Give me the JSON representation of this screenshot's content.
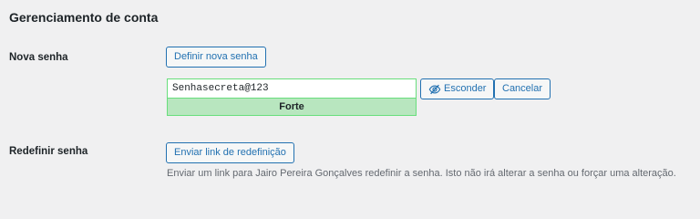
{
  "section": {
    "title": "Gerenciamento de conta"
  },
  "new_password": {
    "label": "Nova senha",
    "generate_button": "Definir nova senha",
    "password_value": "Senhasecreta@123",
    "strength": "Forte",
    "hide_button": "Esconder",
    "cancel_button": "Cancelar",
    "hide_icon": "eye-slash-icon"
  },
  "reset_password": {
    "label": "Redefinir senha",
    "send_link_button": "Enviar link de redefinição",
    "description": "Enviar um link para Jairo Pereira Gonçalves redefinir a senha. Isto não irá alterar a senha ou forçar uma alteração."
  },
  "colors": {
    "accent": "#2271b1",
    "strong_bg": "#b8e6bf",
    "strong_border": "#68de7c",
    "page_bg": "#f0f0f1"
  }
}
